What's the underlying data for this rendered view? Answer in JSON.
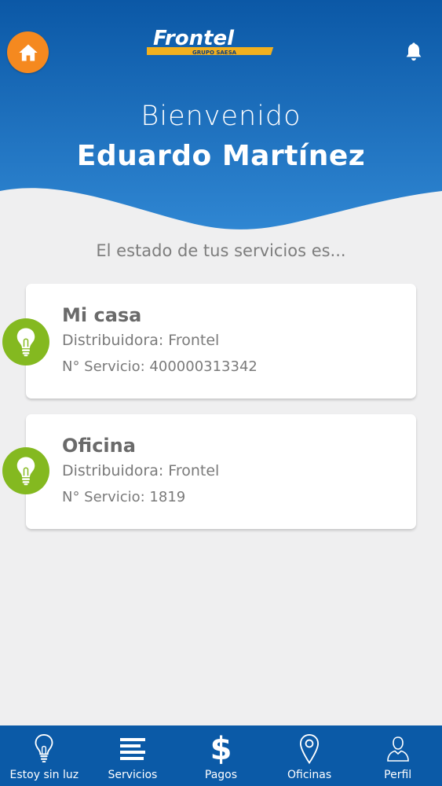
{
  "colors": {
    "header_blue": "#0b5aa7",
    "home_orange": "#f5891f",
    "bulb_green": "#84b920",
    "background": "#efeff0"
  },
  "header": {
    "logo_text": "Frontel",
    "logo_subtext": "GRUPO SAESA",
    "welcome": "Bienvenido",
    "user_name": "Eduardo Martínez",
    "icons": {
      "left": "home-icon",
      "right": "bell-icon"
    }
  },
  "main": {
    "status_intro": "El estado de tus servicios es...",
    "services": [
      {
        "name": "Mi casa",
        "distributor": "Distribuidora: Frontel",
        "service_number": "N° Servicio: 400000313342",
        "icon": "lightbulb-icon"
      },
      {
        "name": "Oficina",
        "distributor": "Distribuidora: Frontel",
        "service_number": "N° Servicio: 1819",
        "icon": "lightbulb-icon"
      }
    ]
  },
  "tabbar": {
    "tabs": [
      {
        "label": "Estoy sin luz",
        "icon": "lightbulb-outline-icon"
      },
      {
        "label": "Servicios",
        "icon": "list-icon"
      },
      {
        "label": "Pagos",
        "icon": "dollar-icon",
        "glyph": "$"
      },
      {
        "label": "Oficinas",
        "icon": "location-pin-icon"
      },
      {
        "label": "Perfil",
        "icon": "user-icon"
      }
    ]
  }
}
